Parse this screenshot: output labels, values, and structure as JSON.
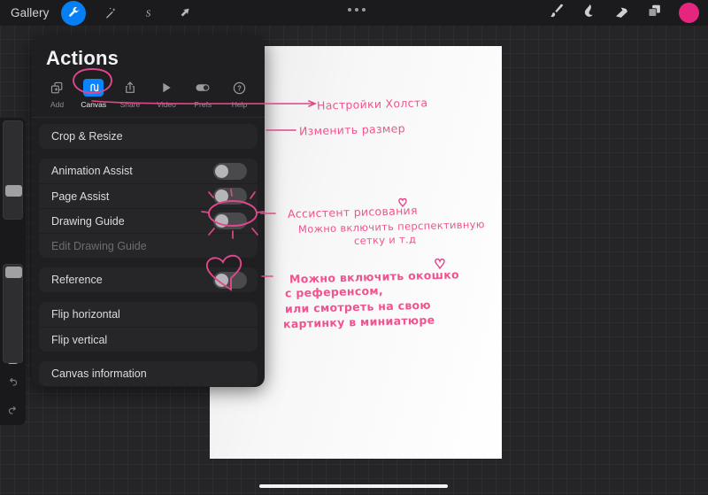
{
  "topbar": {
    "gallery_label": "Gallery",
    "tools": [
      {
        "name": "wrench-icon",
        "label": "Actions",
        "selected": true
      },
      {
        "name": "magic-wand-icon",
        "label": "Adjustments",
        "selected": false
      },
      {
        "name": "selection-s-icon",
        "label": "Selection",
        "selected": false
      },
      {
        "name": "transform-arrow-icon",
        "label": "Transform",
        "selected": false
      }
    ],
    "menu_dots": "•••",
    "right_tools": [
      {
        "name": "paintbrush-icon",
        "label": "Paint"
      },
      {
        "name": "smudge-icon",
        "label": "Smudge"
      },
      {
        "name": "eraser-icon",
        "label": "Erase"
      },
      {
        "name": "layers-icon",
        "label": "Layers"
      }
    ],
    "color_swatch": "#e6257e"
  },
  "sidebar": {
    "brush_size_label": "Brush size",
    "brush_opacity_label": "Brush opacity",
    "modify_label": "Modify",
    "undo_label": "Undo",
    "redo_label": "Redo"
  },
  "panel": {
    "title": "Actions",
    "tabs": [
      {
        "label": "Add",
        "icon": "add-icon",
        "active": false
      },
      {
        "label": "Canvas",
        "icon": "canvas-icon",
        "active": true
      },
      {
        "label": "Share",
        "icon": "share-icon",
        "active": false
      },
      {
        "label": "Video",
        "icon": "video-icon",
        "active": false
      },
      {
        "label": "Prefs",
        "icon": "prefs-icon",
        "active": false
      },
      {
        "label": "Help",
        "icon": "help-icon",
        "active": false
      }
    ],
    "groups": [
      {
        "rows": [
          {
            "label": "Crop & Resize",
            "type": "link",
            "disabled": false
          }
        ]
      },
      {
        "rows": [
          {
            "label": "Animation Assist",
            "type": "toggle",
            "value": false,
            "disabled": false
          },
          {
            "label": "Page Assist",
            "type": "toggle",
            "value": false,
            "disabled": false
          },
          {
            "label": "Drawing Guide",
            "type": "toggle",
            "value": false,
            "disabled": false
          },
          {
            "label": "Edit Drawing Guide",
            "type": "link",
            "disabled": true
          }
        ]
      },
      {
        "rows": [
          {
            "label": "Reference",
            "type": "toggle",
            "value": false,
            "disabled": false
          }
        ]
      },
      {
        "rows": [
          {
            "label": "Flip horizontal",
            "type": "link",
            "disabled": false
          },
          {
            "label": "Flip vertical",
            "type": "link",
            "disabled": false
          }
        ]
      },
      {
        "rows": [
          {
            "label": "Canvas information",
            "type": "link",
            "disabled": false
          }
        ]
      }
    ]
  },
  "annotations": {
    "ink_color": "#f0538f",
    "notes": [
      {
        "id": "note-canvas-settings",
        "text": "Настройки Холста"
      },
      {
        "id": "note-resize",
        "text": "Изменить   размер"
      },
      {
        "id": "note-guide-1",
        "text": "Ассистент  рисования"
      },
      {
        "id": "note-guide-2",
        "text": "Можно включить  перспективную"
      },
      {
        "id": "note-guide-3",
        "text": "сетку   и   т.д"
      },
      {
        "id": "note-ref-1",
        "text": "Можно включить окошко"
      },
      {
        "id": "note-ref-2",
        "text": "с референсом,"
      },
      {
        "id": "note-ref-3",
        "text": "или  смотреть на свою"
      },
      {
        "id": "note-ref-4",
        "text": "картинку в  миниатюре"
      }
    ],
    "marks": [
      {
        "id": "circle-canvas-tab",
        "shape": "circle"
      },
      {
        "id": "circle-drawing-guide-toggle",
        "shape": "sun-circle"
      },
      {
        "id": "heart-reference-toggle",
        "shape": "heart"
      },
      {
        "id": "heart-small-guide",
        "shape": "small-heart"
      },
      {
        "id": "heart-small-ref",
        "shape": "small-heart"
      }
    ]
  }
}
